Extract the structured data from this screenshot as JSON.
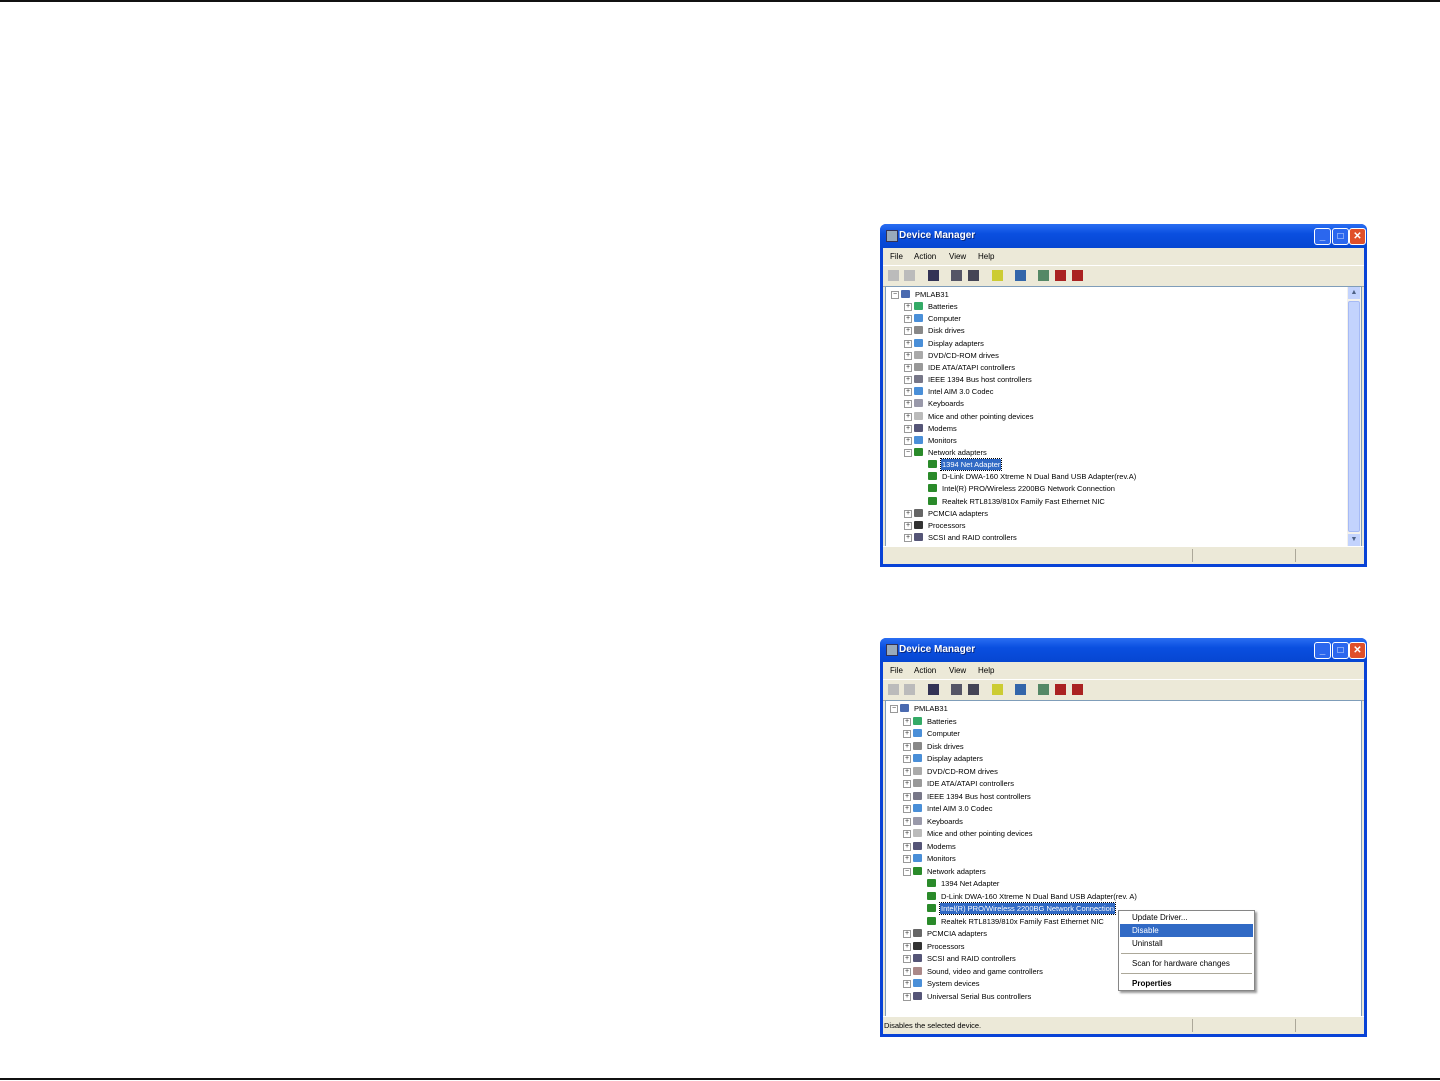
{
  "windows": [
    {
      "title": "Device Manager",
      "menu": [
        "File",
        "Action",
        "View",
        "Help"
      ],
      "root": "PMLAB31",
      "categories": [
        "Batteries",
        "Computer",
        "Disk drives",
        "Display adapters",
        "DVD/CD-ROM drives",
        "IDE ATA/ATAPI controllers",
        "IEEE 1394 Bus host controllers",
        "Intel AIM 3.0 Codec",
        "Keyboards",
        "Mice and other pointing devices",
        "Modems",
        "Monitors",
        "Network adapters"
      ],
      "network_adapters": [
        "1394 Net Adapter",
        "D-Link DWA-160 Xtreme N Dual Band USB Adapter(rev.A)",
        "Intel(R) PRO/Wireless 2200BG Network Connection",
        "Realtek RTL8139/810x Family Fast Ethernet NIC"
      ],
      "after": [
        "PCMCIA adapters",
        "Processors",
        "SCSI and RAID controllers"
      ],
      "selected": "1394 Net Adapter",
      "status": ""
    },
    {
      "title": "Device Manager",
      "menu": [
        "File",
        "Action",
        "View",
        "Help"
      ],
      "root": "PMLAB31",
      "categories": [
        "Batteries",
        "Computer",
        "Disk drives",
        "Display adapters",
        "DVD/CD-ROM drives",
        "IDE ATA/ATAPI controllers",
        "IEEE 1394 Bus host controllers",
        "Intel AIM 3.0 Codec",
        "Keyboards",
        "Mice and other pointing devices",
        "Modems",
        "Monitors",
        "Network adapters"
      ],
      "network_adapters": [
        "1394 Net Adapter",
        "D-Link DWA-160 Xtreme N Dual Band USB Adapter(rev. A)",
        "Intel(R) PRO/Wireless 2200BG Network Connection",
        "Realtek RTL8139/810x Family Fast Ethernet NIC"
      ],
      "after": [
        "PCMCIA adapters",
        "Processors",
        "SCSI and RAID controllers",
        "Sound, video and game controllers",
        "System devices",
        "Universal Serial Bus controllers"
      ],
      "selected": "Intel(R) PRO/Wireless 2200BG Network Connection",
      "status": "Disables the selected device.",
      "context_menu": {
        "items": [
          "Update Driver...",
          "Disable",
          "Uninstall",
          "Scan for hardware changes",
          "Properties"
        ],
        "highlighted": "Disable"
      }
    }
  ],
  "colors": {
    "title_bar": "#0a4fe0",
    "selection": "#316ac5",
    "close_button": "#e0502a"
  }
}
